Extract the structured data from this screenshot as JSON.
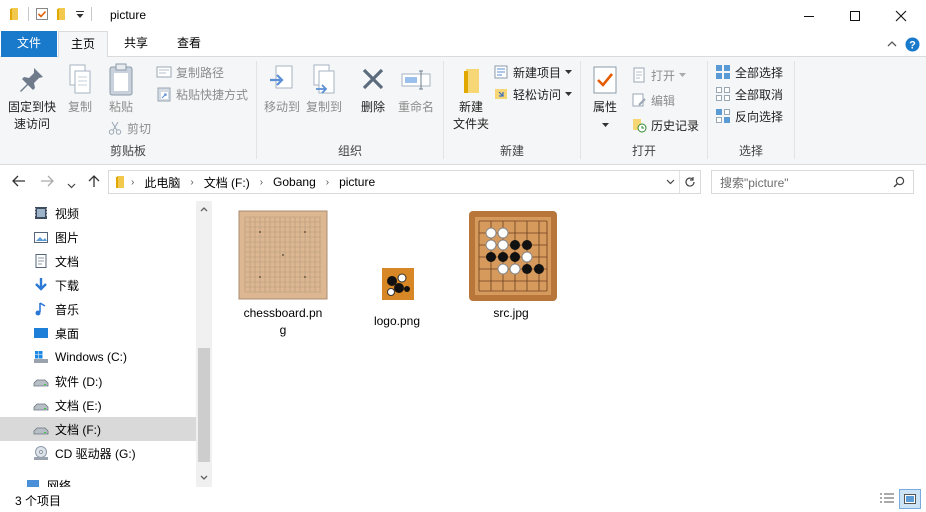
{
  "window": {
    "title": "picture"
  },
  "ribbon_tabs": [
    "文件",
    "主页",
    "共享",
    "查看"
  ],
  "clipboard": {
    "pin_label_1": "固定到快",
    "pin_label_2": "速访问",
    "copy": "复制",
    "paste": "粘贴",
    "copy_path": "复制路径",
    "paste_shortcut": "粘贴快捷方式",
    "cut": "剪切",
    "group": "剪贴板"
  },
  "organize": {
    "move_to": "移动到",
    "copy_to": "复制到",
    "delete": "删除",
    "rename": "重命名",
    "group": "组织"
  },
  "new": {
    "new_folder_1": "新建",
    "new_folder_2": "文件夹",
    "new_item": "新建项目",
    "easy_access": "轻松访问",
    "group": "新建"
  },
  "open": {
    "properties": "属性",
    "open": "打开",
    "edit": "编辑",
    "history": "历史记录",
    "group": "打开"
  },
  "select": {
    "select_all": "全部选择",
    "select_none": "全部取消",
    "invert": "反向选择",
    "group": "选择"
  },
  "address": {
    "crumbs": [
      "此电脑",
      "文档 (F:)",
      "Gobang",
      "picture"
    ],
    "search_placeholder": "搜索\"picture\""
  },
  "nav": [
    {
      "label": "视频",
      "icon": "video-folder-icon"
    },
    {
      "label": "图片",
      "icon": "pictures-folder-icon"
    },
    {
      "label": "文档",
      "icon": "documents-folder-icon"
    },
    {
      "label": "下载",
      "icon": "downloads-folder-icon"
    },
    {
      "label": "音乐",
      "icon": "music-folder-icon"
    },
    {
      "label": "桌面",
      "icon": "desktop-folder-icon"
    },
    {
      "label": "Windows (C:)",
      "icon": "windows-drive-icon"
    },
    {
      "label": "软件 (D:)",
      "icon": "drive-icon"
    },
    {
      "label": "文档 (E:)",
      "icon": "drive-icon"
    },
    {
      "label": "文档 (F:)",
      "icon": "drive-icon",
      "selected": true
    },
    {
      "label": "CD 驱动器 (G:)",
      "icon": "cd-drive-icon"
    },
    {
      "label": "网络",
      "icon": "network-icon"
    }
  ],
  "files": [
    {
      "name_line1": "chessboard.pn",
      "name_line2": "g"
    },
    {
      "name_line1": "logo.png",
      "name_line2": ""
    },
    {
      "name_line1": "src.jpg",
      "name_line2": ""
    }
  ],
  "status": {
    "item_count": "3 个项目"
  },
  "colors": {
    "accent": "#1979ca",
    "ribbon_bg": "#f5f6f7",
    "folder_yellow": "#f2c94c",
    "board_tan": "#dcb792",
    "src_bg": "#b9763b"
  }
}
